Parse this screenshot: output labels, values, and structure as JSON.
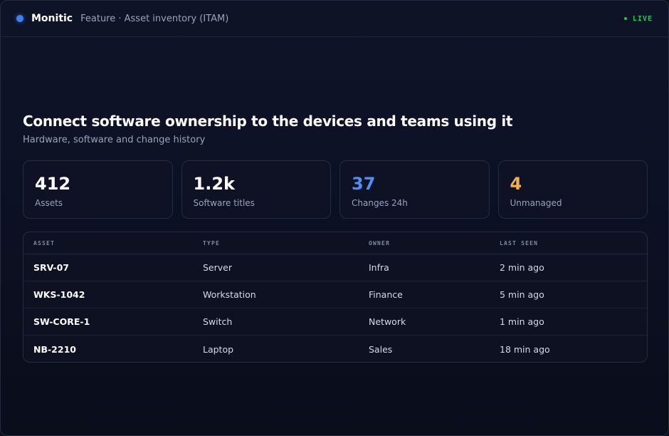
{
  "app": {
    "name": "Monitic",
    "breadcrumb": "Feature · Asset inventory (ITAM)",
    "status": "LIVE"
  },
  "hero": {
    "title": "Connect software ownership to the devices and teams using it",
    "subtitle": "Hardware, software and change history"
  },
  "stats": [
    {
      "value": "412",
      "label": "Assets",
      "color": "#ffffff"
    },
    {
      "value": "1.2k",
      "label": "Software titles",
      "color": "#ffffff"
    },
    {
      "value": "37",
      "label": "Changes 24h",
      "color": "#4f8ff7"
    },
    {
      "value": "4",
      "label": "Unmanaged",
      "color": "#f5b04a"
    }
  ],
  "table": {
    "columns": [
      "ASSET",
      "TYPE",
      "OWNER",
      "LAST SEEN"
    ],
    "rows": [
      {
        "asset": "SRV-07",
        "type": "Server",
        "owner": "Infra",
        "last_seen": "2 min ago"
      },
      {
        "asset": "WKS-1042",
        "type": "Workstation",
        "owner": "Finance",
        "last_seen": "5 min ago"
      },
      {
        "asset": "SW-CORE-1",
        "type": "Switch",
        "owner": "Network",
        "last_seen": "1 min ago"
      },
      {
        "asset": "NB-2210",
        "type": "Laptop",
        "owner": "Sales",
        "last_seen": "18 min ago"
      }
    ]
  },
  "colors": {
    "accent": "#3b82f6",
    "live": "#22c55e"
  }
}
